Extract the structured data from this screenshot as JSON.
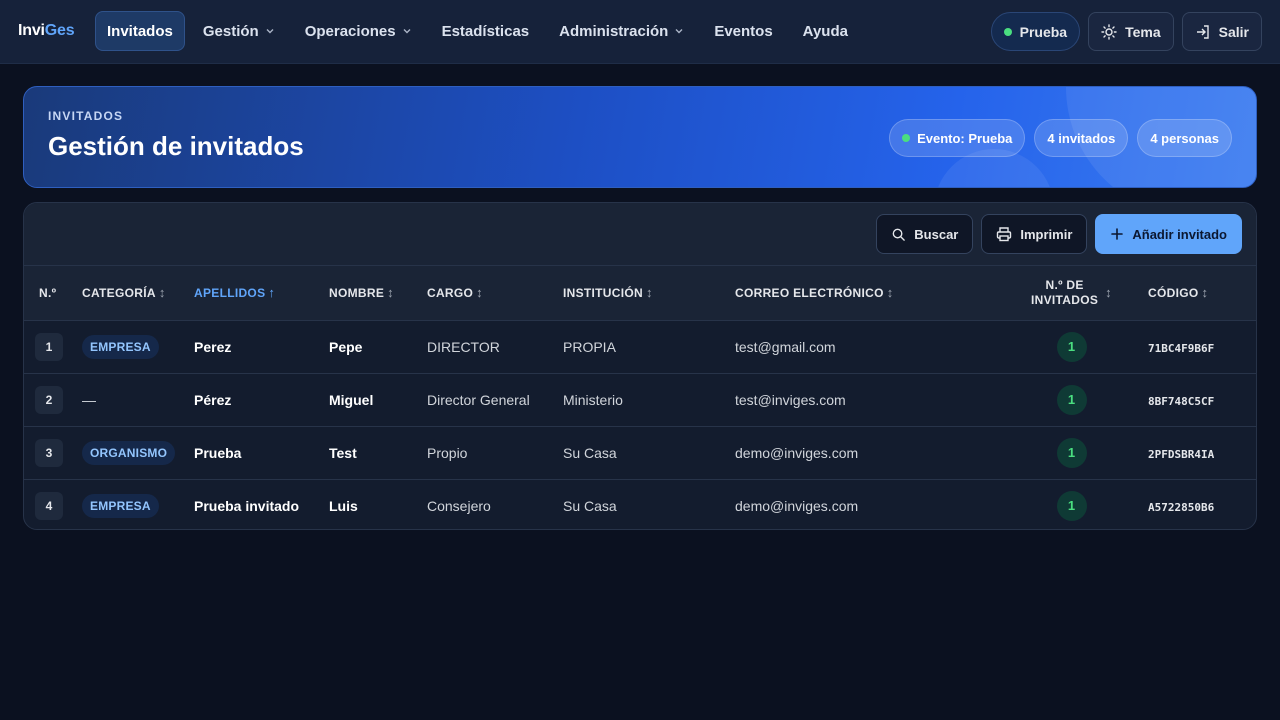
{
  "brand": {
    "part1": "Invi",
    "part2": "Ges"
  },
  "nav": {
    "items": [
      {
        "label": "Invitados",
        "active": true,
        "dropdown": false
      },
      {
        "label": "Gestión",
        "active": false,
        "dropdown": true
      },
      {
        "label": "Operaciones",
        "active": false,
        "dropdown": true
      },
      {
        "label": "Estadísticas",
        "active": false,
        "dropdown": false
      },
      {
        "label": "Administración",
        "active": false,
        "dropdown": true
      },
      {
        "label": "Eventos",
        "active": false,
        "dropdown": false
      },
      {
        "label": "Ayuda",
        "active": false,
        "dropdown": false
      }
    ],
    "event_label": "Prueba",
    "theme_label": "Tema",
    "logout_label": "Salir"
  },
  "hero": {
    "eyebrow": "INVITADOS",
    "title": "Gestión de invitados",
    "badges": {
      "event": "Evento: Prueba",
      "guests": "4 invitados",
      "people": "4 personas"
    }
  },
  "toolbar": {
    "search_label": "Buscar",
    "print_label": "Imprimir",
    "add_label": "Añadir invitado"
  },
  "table": {
    "headers": {
      "num": "N.º",
      "category": "CATEGORÍA",
      "surname": "APELLIDOS",
      "name": "NOMBRE",
      "position": "CARGO",
      "institution": "INSTITUCIÓN",
      "email": "CORREO ELECTRÓNICO",
      "guests_line1": "N.º DE",
      "guests_line2": "INVITADOS",
      "code": "CÓDIGO"
    },
    "sort_icon": "↕",
    "sorted_icon": "↑",
    "rows": [
      {
        "num": "1",
        "category": "EMPRESA",
        "surname": "Perez",
        "name": "Pepe",
        "position": "DIRECTOR",
        "institution": "PROPIA",
        "email": "test@gmail.com",
        "guests": "1",
        "code": "71BC4F9B6F"
      },
      {
        "num": "2",
        "category": "—",
        "surname": "Pérez",
        "name": "Miguel",
        "position": "Director General",
        "institution": "Ministerio",
        "email": "test@inviges.com",
        "guests": "1",
        "code": "8BF748C5CF"
      },
      {
        "num": "3",
        "category": "ORGANISMO",
        "surname": "Prueba",
        "name": "Test",
        "position": "Propio",
        "institution": "Su Casa",
        "email": "demo@inviges.com",
        "guests": "1",
        "code": "2PFDSBR4IA"
      },
      {
        "num": "4",
        "category": "EMPRESA",
        "surname": "Prueba invitado",
        "name": "Luis",
        "position": "Consejero",
        "institution": "Su Casa",
        "email": "demo@inviges.com",
        "guests": "1",
        "code": "A5722850B6"
      }
    ]
  }
}
